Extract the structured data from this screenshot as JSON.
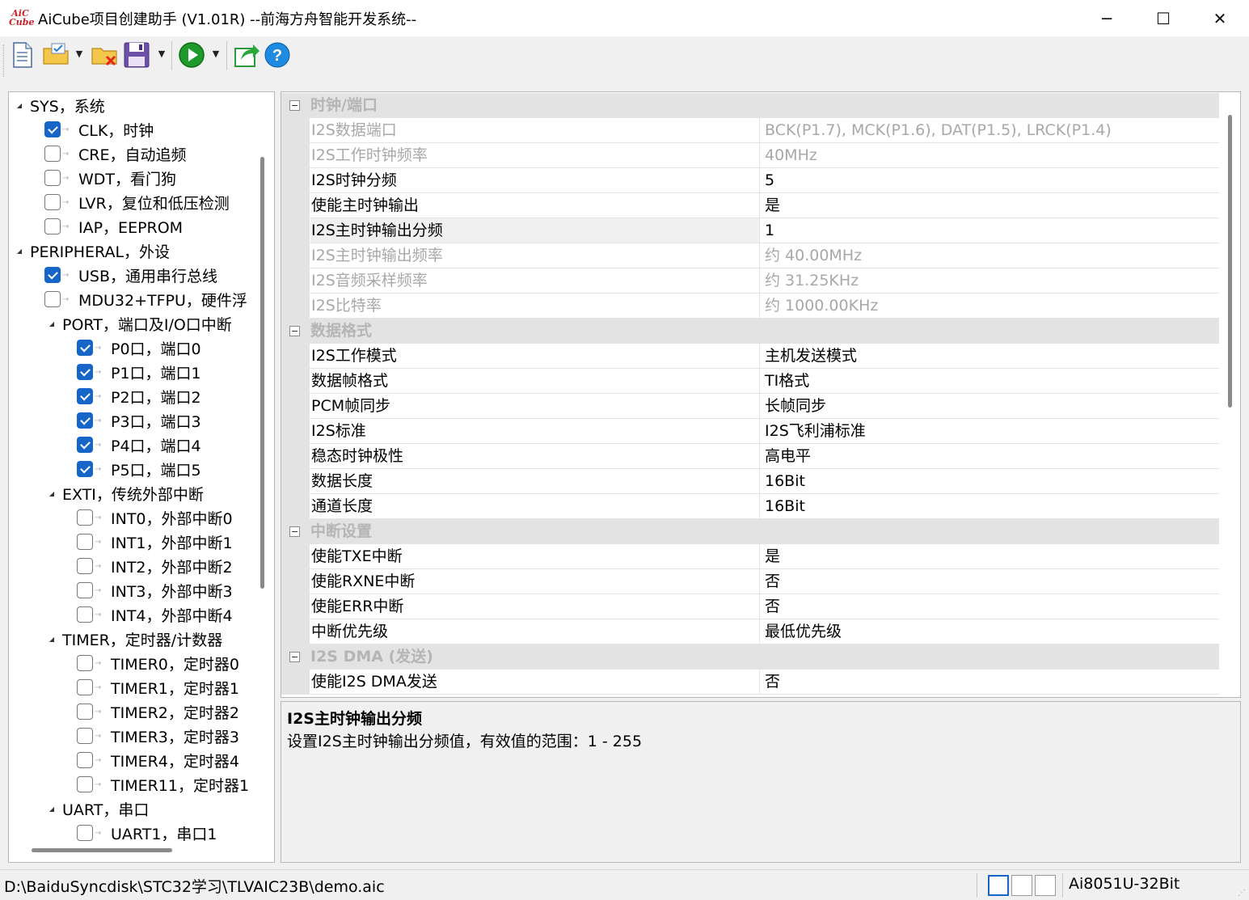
{
  "window": {
    "logo_text": "AiC Cube",
    "title": "AiCube项目创建助手 (V1.01R) --前海方舟智能开发系统--",
    "minimize": "─",
    "maximize": "☐",
    "close": "✕"
  },
  "toolbar": {
    "buttons": [
      "new-file-icon",
      "open-folder-icon",
      "close-folder-icon",
      "save-icon",
      "run-icon",
      "export-icon",
      "help-icon"
    ],
    "help_label": "?"
  },
  "tree": {
    "items": [
      {
        "label": "SYS，系统",
        "checked": null,
        "expanded": true
      },
      {
        "label": "CLK，时钟",
        "checked": true
      },
      {
        "label": "CRE，自动追频",
        "checked": false
      },
      {
        "label": "WDT，看门狗",
        "checked": false
      },
      {
        "label": "LVR，复位和低压检测",
        "checked": false
      },
      {
        "label": "IAP，EEPROM",
        "checked": false
      },
      {
        "label": "PERIPHERAL，外设",
        "checked": null,
        "expanded": true
      },
      {
        "label": "USB，通用串行总线",
        "checked": true
      },
      {
        "label": "MDU32+TFPU，硬件浮",
        "checked": false
      },
      {
        "label": "PORT，端口及I/O口中断",
        "checked": null,
        "expanded": true
      },
      {
        "label": "P0口，端口0",
        "checked": true
      },
      {
        "label": "P1口，端口1",
        "checked": true
      },
      {
        "label": "P2口，端口2",
        "checked": true
      },
      {
        "label": "P3口，端口3",
        "checked": true
      },
      {
        "label": "P4口，端口4",
        "checked": true
      },
      {
        "label": "P5口，端口5",
        "checked": true
      },
      {
        "label": "EXTI，传统外部中断",
        "checked": null,
        "expanded": true
      },
      {
        "label": "INT0，外部中断0",
        "checked": false
      },
      {
        "label": "INT1，外部中断1",
        "checked": false
      },
      {
        "label": "INT2，外部中断2",
        "checked": false
      },
      {
        "label": "INT3，外部中断3",
        "checked": false
      },
      {
        "label": "INT4，外部中断4",
        "checked": false
      },
      {
        "label": "TIMER，定时器/计数器",
        "checked": null,
        "expanded": true
      },
      {
        "label": "TIMER0，定时器0",
        "checked": false
      },
      {
        "label": "TIMER1，定时器1",
        "checked": false
      },
      {
        "label": "TIMER2，定时器2",
        "checked": false
      },
      {
        "label": "TIMER3，定时器3",
        "checked": false
      },
      {
        "label": "TIMER4，定时器4",
        "checked": false
      },
      {
        "label": "TIMER11，定时器1",
        "checked": false
      },
      {
        "label": "UART，串口",
        "checked": null,
        "expanded": true
      },
      {
        "label": "UART1，串口1",
        "checked": false
      }
    ]
  },
  "grid": {
    "rows": [
      {
        "type": "category",
        "label": "时钟/端口"
      },
      {
        "type": "prop",
        "name": "I2S数据端口",
        "value": "BCK(P1.7), MCK(P1.6), DAT(P1.5), LRCK(P1.4)",
        "readonly": true
      },
      {
        "type": "prop",
        "name": "I2S工作时钟频率",
        "value": "40MHz",
        "readonly": true
      },
      {
        "type": "prop",
        "name": "I2S时钟分频",
        "value": "5",
        "readonly": false
      },
      {
        "type": "prop",
        "name": "使能主时钟输出",
        "value": "是",
        "readonly": false
      },
      {
        "type": "prop",
        "name": "I2S主时钟输出分频",
        "value": "1",
        "readonly": false,
        "selected": true
      },
      {
        "type": "prop",
        "name": "I2S主时钟输出频率",
        "value": "约 40.00MHz",
        "readonly": true
      },
      {
        "type": "prop",
        "name": "I2S音频采样频率",
        "value": "约 31.25KHz",
        "readonly": true
      },
      {
        "type": "prop",
        "name": "I2S比特率",
        "value": "约 1000.00KHz",
        "readonly": true
      },
      {
        "type": "category",
        "label": "数据格式"
      },
      {
        "type": "prop",
        "name": "I2S工作模式",
        "value": "主机发送模式",
        "readonly": false
      },
      {
        "type": "prop",
        "name": "数据帧格式",
        "value": "TI格式",
        "readonly": false
      },
      {
        "type": "prop",
        "name": "PCM帧同步",
        "value": "长帧同步",
        "readonly": false
      },
      {
        "type": "prop",
        "name": "I2S标准",
        "value": "I2S飞利浦标准",
        "readonly": false
      },
      {
        "type": "prop",
        "name": "稳态时钟极性",
        "value": "高电平",
        "readonly": false
      },
      {
        "type": "prop",
        "name": "数据长度",
        "value": "16Bit",
        "readonly": false
      },
      {
        "type": "prop",
        "name": "通道长度",
        "value": "16Bit",
        "readonly": false
      },
      {
        "type": "category",
        "label": "中断设置"
      },
      {
        "type": "prop",
        "name": "使能TXE中断",
        "value": "是",
        "readonly": false
      },
      {
        "type": "prop",
        "name": "使能RXNE中断",
        "value": "否",
        "readonly": false
      },
      {
        "type": "prop",
        "name": "使能ERR中断",
        "value": "否",
        "readonly": false
      },
      {
        "type": "prop",
        "name": "中断优先级",
        "value": "最低优先级",
        "readonly": false
      },
      {
        "type": "category",
        "label": "I2S DMA (发送)"
      },
      {
        "type": "prop",
        "name": "使能I2S DMA发送",
        "value": "否",
        "readonly": false
      }
    ]
  },
  "description": {
    "title": "I2S主时钟输出分频",
    "text": "设置I2S主时钟输出分频值，有效值的范围：1 - 255"
  },
  "status": {
    "path": "D:\\BaiduSyncdisk\\STC32学习\\TLVAIC23B\\demo.aic",
    "chip": "Ai8051U-32Bit"
  },
  "colors": {
    "accent": "#1566c8",
    "category_bg": "#e3e3e3",
    "readonly_text": "#a8a8a8"
  }
}
